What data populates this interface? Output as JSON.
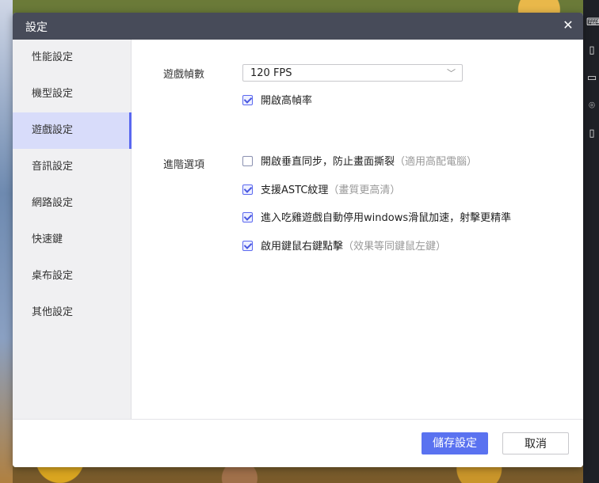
{
  "window": {
    "title": "設定"
  },
  "sidebar": {
    "items": [
      {
        "label": "性能設定"
      },
      {
        "label": "機型設定"
      },
      {
        "label": "遊戲設定"
      },
      {
        "label": "音訊設定"
      },
      {
        "label": "網路設定"
      },
      {
        "label": "快速鍵"
      },
      {
        "label": "桌布設定"
      },
      {
        "label": "其他設定"
      }
    ],
    "active_index": 2
  },
  "game": {
    "fps_label": "遊戲幀數",
    "fps_value": "120 FPS",
    "high_fps": {
      "label": "開啟高幀率",
      "checked": true
    },
    "advanced_label": "進階選項",
    "options": [
      {
        "label": "開啟垂直同步，防止畫面撕裂",
        "note": "（適用高配電腦）",
        "checked": false
      },
      {
        "label": "支援ASTC紋理",
        "note": "（畫質更高清）",
        "checked": true
      },
      {
        "label": "進入吃雞遊戲自動停用windows滑鼠加速，射擊更精準",
        "note": "",
        "checked": true
      },
      {
        "label": "啟用鍵鼠右鍵點擊",
        "note": "（效果等同鍵鼠左鍵）",
        "checked": true
      }
    ]
  },
  "footer": {
    "save_label": "儲存設定",
    "cancel_label": "取消"
  },
  "colors": {
    "accent": "#5a72f0",
    "titlebar": "#474b59",
    "sidebar_active": "#d8dcfa"
  }
}
